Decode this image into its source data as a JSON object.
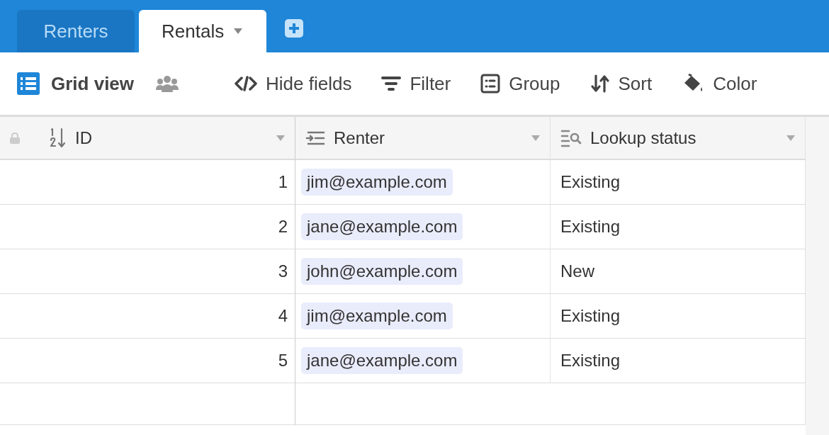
{
  "tabs": [
    {
      "label": "Renters",
      "selected": false
    },
    {
      "label": "Rentals",
      "selected": true
    }
  ],
  "toolbar": {
    "view_name": "Grid view",
    "actions": [
      {
        "kind": "hide",
        "label": "Hide fields"
      },
      {
        "kind": "filter",
        "label": "Filter"
      },
      {
        "kind": "group",
        "label": "Group"
      },
      {
        "kind": "sort",
        "label": "Sort"
      },
      {
        "kind": "color",
        "label": "Color"
      }
    ]
  },
  "table": {
    "columns": [
      {
        "kind": "number",
        "label": "ID"
      },
      {
        "kind": "link",
        "label": "Renter"
      },
      {
        "kind": "lookup",
        "label": "Lookup status"
      }
    ],
    "rows": [
      {
        "id": "1",
        "renter": "jim@example.com",
        "status": "Existing"
      },
      {
        "id": "2",
        "renter": "jane@example.com",
        "status": "Existing"
      },
      {
        "id": "3",
        "renter": "john@example.com",
        "status": "New"
      },
      {
        "id": "4",
        "renter": "jim@example.com",
        "status": "Existing"
      },
      {
        "id": "5",
        "renter": "jane@example.com",
        "status": "Existing"
      }
    ]
  }
}
